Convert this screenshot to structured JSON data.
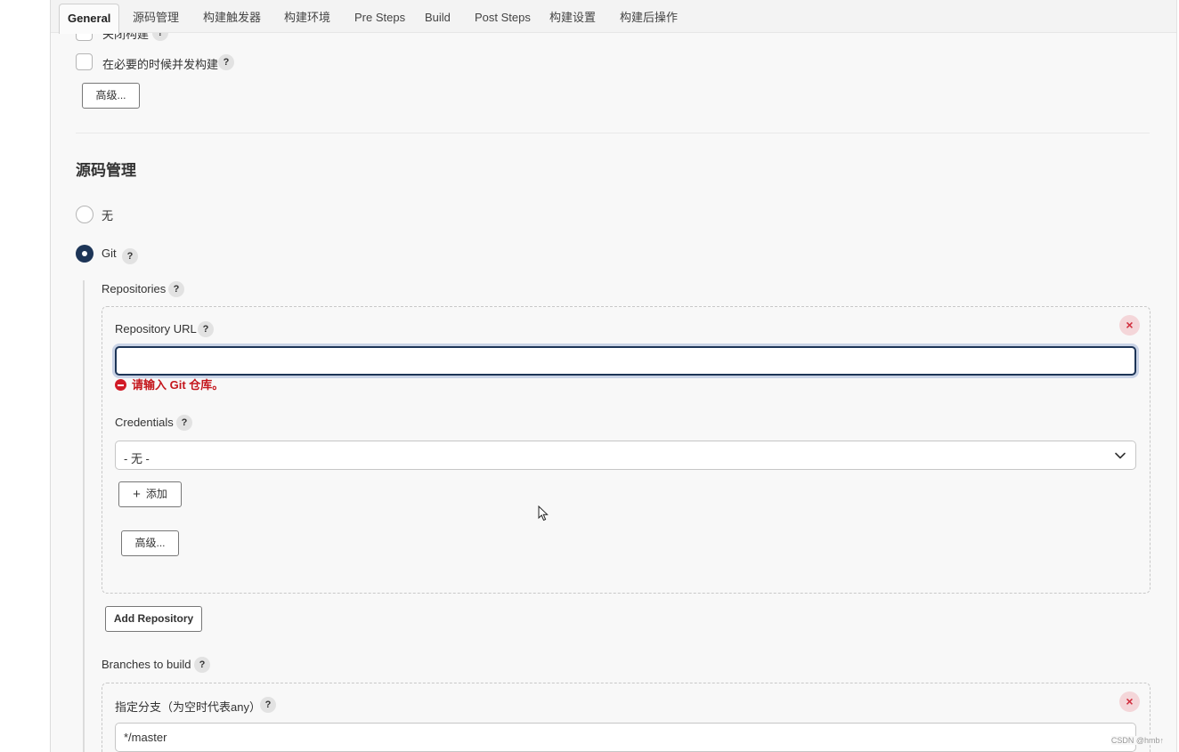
{
  "tabs": [
    {
      "label": "General",
      "active": true
    },
    {
      "label": "源码管理"
    },
    {
      "label": "构建触发器"
    },
    {
      "label": "构建环境"
    },
    {
      "label": "Pre Steps"
    },
    {
      "label": "Build"
    },
    {
      "label": "Post Steps"
    },
    {
      "label": "构建设置"
    },
    {
      "label": "构建后操作"
    }
  ],
  "general": {
    "partial_option_label": "关闭构建",
    "concurrent_build_label": "在必要的时候并发构建",
    "advanced_label": "高级..."
  },
  "scm": {
    "title": "源码管理",
    "none_label": "无",
    "git_label": "Git",
    "repositories_label": "Repositories",
    "repo_url_label": "Repository URL",
    "repo_url_value": "",
    "repo_url_error": "请输入 Git 仓库。",
    "credentials_label": "Credentials",
    "credentials_selected": "- 无 -",
    "add_label": "添加",
    "advanced_label": "高级...",
    "add_repository_label": "Add Repository",
    "branches_label": "Branches to build",
    "branch_specifier_label": "指定分支（为空时代表any）",
    "branch_specifier_value": "*/master"
  },
  "help_glyph": "?",
  "close_glyph": "×",
  "watermark": "CSDN @hmb↑",
  "colors": {
    "accent": "#1d3557",
    "error": "#c4161c",
    "delete_bg": "#f4d6d9"
  }
}
